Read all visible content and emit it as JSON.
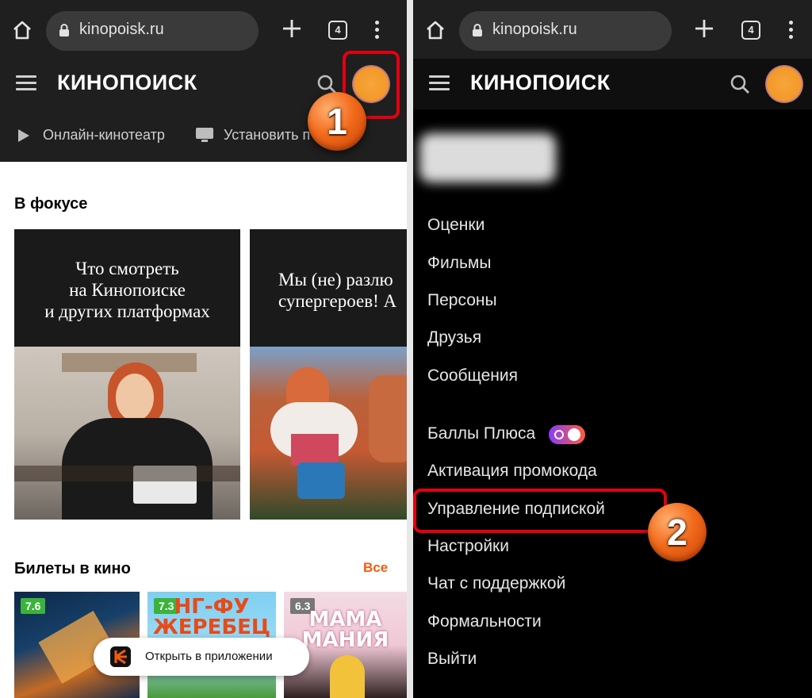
{
  "browser": {
    "url": "kinopoisk.ru",
    "tab_count": "4"
  },
  "header": {
    "logo": "КИНОПОИСК"
  },
  "left": {
    "nav": [
      "Онлайн-кинотеатр",
      "Установить п"
    ],
    "focus_title": "В фокусе",
    "cards": [
      {
        "text": "Что смотреть\nна Кинопоиске\nи других платформах"
      },
      {
        "text": "Мы (не) разлю\nсупергероев! А"
      }
    ],
    "tickets_title": "Билеты в кино",
    "all_link": "Все",
    "posters": [
      {
        "rating": "7.6",
        "rating_color": "#3bb33b",
        "title": ""
      },
      {
        "rating": "7.3",
        "rating_color": "#3bb33b",
        "title": "НГ-ФУ\nЖЕРЕБЕЦ"
      },
      {
        "rating": "6.3",
        "rating_color": "#777777",
        "title": "МАМА\nМАНИЯ"
      }
    ],
    "open_app": "Открыть в приложении"
  },
  "right": {
    "menu": [
      "Оценки",
      "Фильмы",
      "Персоны",
      "Друзья",
      "Сообщения",
      "Баллы Плюса",
      "Активация промокода",
      "Управление подпиской",
      "Настройки",
      "Чат с поддержкой",
      "Формальности",
      "Выйти"
    ]
  },
  "annotations": [
    "1",
    "2"
  ],
  "colors": {
    "highlight": "#e30010",
    "badge": "#f26a1b",
    "accent": "#f35b0c"
  }
}
